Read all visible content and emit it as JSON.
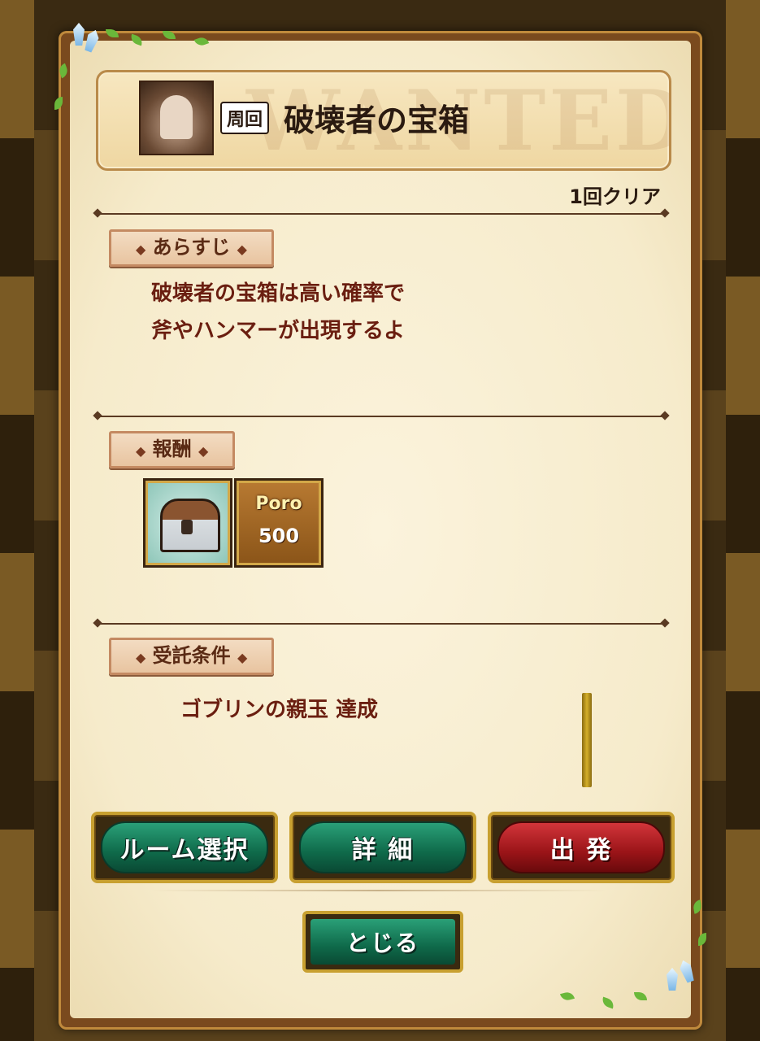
{
  "quest": {
    "badge": "周回",
    "title": "破壊者の宝箱",
    "watermark": "WANTED",
    "clear_status": "1回クリア"
  },
  "sections": {
    "synopsis_label": "あらすじ",
    "synopsis_text": "破壊者の宝箱は高い確率で\n斧やハンマーが出現するよ",
    "reward_label": "報酬",
    "condition_label": "受託条件",
    "condition_text": "ゴブリンの親玉 達成"
  },
  "rewards": [
    {
      "type": "treasure-chest"
    },
    {
      "type": "currency",
      "name": "Poro",
      "amount": "500"
    }
  ],
  "buttons": {
    "room_select": "ルーム選択",
    "detail": "詳 細",
    "depart": "出 発",
    "close": "とじる"
  },
  "colors": {
    "panel": "#f6ebcb",
    "frame": "#7a4a1e",
    "text_red": "#6a1e10",
    "button_green": "#0f6a4a",
    "button_red": "#9a1418",
    "button_border": "#c8a030"
  }
}
